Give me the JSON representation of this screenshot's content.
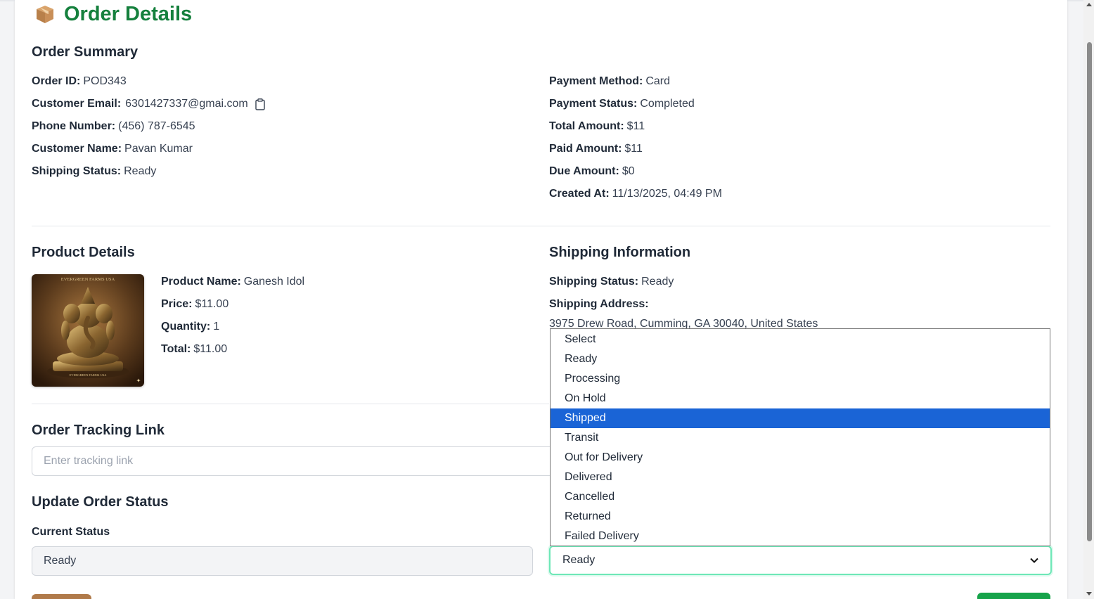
{
  "page": {
    "title": "Order Details",
    "icon": "package-icon"
  },
  "order_summary": {
    "heading": "Order Summary",
    "left": [
      {
        "label": "Order ID:",
        "value": "POD343"
      },
      {
        "label": "Customer Email:",
        "value": "6301427337@gmai.com"
      },
      {
        "label": "Phone Number:",
        "value": "(456) 787-6545"
      },
      {
        "label": "Customer Name:",
        "value": "Pavan Kumar"
      },
      {
        "label": "Shipping Status:",
        "value": "Ready"
      }
    ],
    "right": [
      {
        "label": "Payment Method:",
        "value": "Card"
      },
      {
        "label": "Payment Status:",
        "value": "Completed"
      },
      {
        "label": "Total Amount:",
        "value": "$11"
      },
      {
        "label": "Paid Amount:",
        "value": "$11"
      },
      {
        "label": "Due Amount:",
        "value": "$0"
      },
      {
        "label": "Created At:",
        "value": "11/13/2025, 04:49 PM"
      }
    ]
  },
  "product_details": {
    "heading": "Product Details",
    "image_text_top": "EVERGREEN FARMS USA",
    "image_text_bottom": "EVERGREEN FARMS USA",
    "fields": [
      {
        "label": "Product Name:",
        "value": "Ganesh Idol"
      },
      {
        "label": "Price:",
        "value": "$11.00"
      },
      {
        "label": "Quantity:",
        "value": "1"
      },
      {
        "label": "Total:",
        "value": "$11.00"
      }
    ]
  },
  "shipping_info": {
    "heading": "Shipping Information",
    "status_label": "Shipping Status:",
    "status_value": "Ready",
    "address_label": "Shipping Address:",
    "address_value": "3975 Drew Road, Cumming, GA 30040, United States"
  },
  "tracking": {
    "heading": "Order Tracking Link",
    "placeholder": "Enter tracking link"
  },
  "update_status": {
    "heading": "Update Order Status",
    "current_label": "Current Status",
    "current_value": "Ready",
    "select_value": "Ready",
    "options": [
      "Select",
      "Ready",
      "Processing",
      "On Hold",
      "Shipped",
      "Transit",
      "Out for Delivery",
      "Delivered",
      "Cancelled",
      "Returned",
      "Failed Delivery"
    ],
    "highlighted_option": "Shipped"
  },
  "colors": {
    "title_green": "#15803d",
    "highlight_blue": "#1a64d6",
    "focus_ring": "#6ee7b7"
  }
}
